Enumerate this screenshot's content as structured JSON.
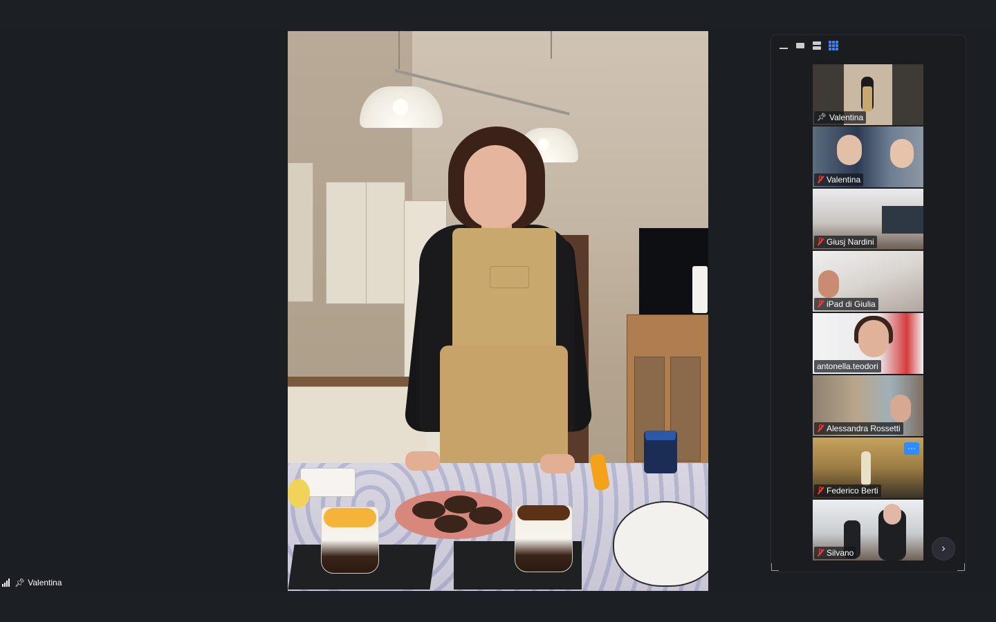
{
  "meeting": {
    "speaker_label": "Valentina",
    "view_controls": [
      "minimize",
      "speaker-view-single",
      "speaker-view-stack",
      "gallery-view"
    ]
  },
  "participants": [
    {
      "name": "Valentina",
      "status": "pinned",
      "active": true
    },
    {
      "name": "Valentina",
      "status": "muted",
      "active": false
    },
    {
      "name": "Giusj Nardini",
      "status": "muted",
      "active": false
    },
    {
      "name": "iPad di Giulia",
      "status": "muted",
      "active": false
    },
    {
      "name": "antonella.teodori",
      "status": "none",
      "active": false
    },
    {
      "name": "Alessandra Rossetti",
      "status": "muted",
      "active": false
    },
    {
      "name": "Federico Berti",
      "status": "muted",
      "active": false,
      "more_label": "···"
    },
    {
      "name": "Silvano",
      "status": "muted",
      "active": false
    }
  ],
  "icons": {
    "pin": "pin-icon",
    "mute": "mic-muted-icon",
    "signal": "signal-icon",
    "next": "chevron-right-icon"
  },
  "colors": {
    "active_border": "#23d160",
    "mute_red": "#ff3b30",
    "accent_blue": "#2d8cff"
  }
}
